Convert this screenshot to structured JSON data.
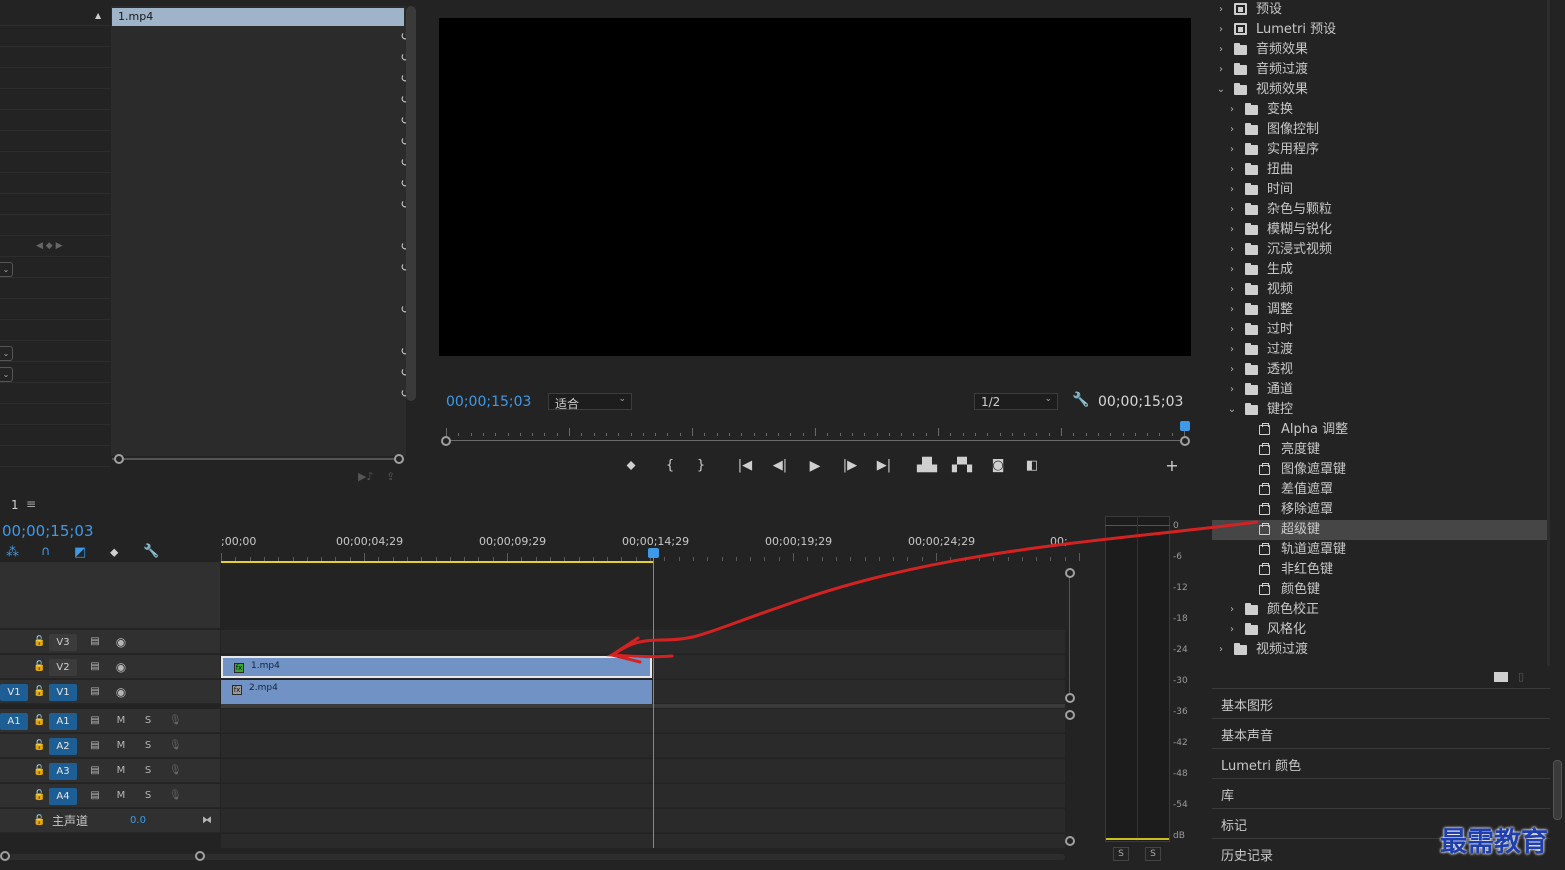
{
  "effect_controls": {
    "clip_name": "1.mp4",
    "reset_rows": 19
  },
  "program": {
    "timecode_left": "00;00;15;03",
    "fit_label": "适合",
    "resolution_label": "1/2",
    "timecode_right": "00;00;15;03"
  },
  "effects_tree": [
    {
      "label": "预设",
      "level": 0,
      "icon": "preset",
      "open": false
    },
    {
      "label": "Lumetri 预设",
      "level": 0,
      "icon": "preset",
      "open": false
    },
    {
      "label": "音频效果",
      "level": 0,
      "icon": "folder",
      "open": false
    },
    {
      "label": "音频过渡",
      "level": 0,
      "icon": "folder",
      "open": false
    },
    {
      "label": "视频效果",
      "level": 0,
      "icon": "folder",
      "open": true
    },
    {
      "label": "变换",
      "level": 1,
      "icon": "folder",
      "open": false
    },
    {
      "label": "图像控制",
      "level": 1,
      "icon": "folder",
      "open": false
    },
    {
      "label": "实用程序",
      "level": 1,
      "icon": "folder",
      "open": false
    },
    {
      "label": "扭曲",
      "level": 1,
      "icon": "folder",
      "open": false
    },
    {
      "label": "时间",
      "level": 1,
      "icon": "folder",
      "open": false
    },
    {
      "label": "杂色与颗粒",
      "level": 1,
      "icon": "folder",
      "open": false
    },
    {
      "label": "模糊与锐化",
      "level": 1,
      "icon": "folder",
      "open": false
    },
    {
      "label": "沉浸式视频",
      "level": 1,
      "icon": "folder",
      "open": false
    },
    {
      "label": "生成",
      "level": 1,
      "icon": "folder",
      "open": false
    },
    {
      "label": "视频",
      "level": 1,
      "icon": "folder",
      "open": false
    },
    {
      "label": "调整",
      "level": 1,
      "icon": "folder",
      "open": false
    },
    {
      "label": "过时",
      "level": 1,
      "icon": "folder",
      "open": false
    },
    {
      "label": "过渡",
      "level": 1,
      "icon": "folder",
      "open": false
    },
    {
      "label": "透视",
      "level": 1,
      "icon": "folder",
      "open": false
    },
    {
      "label": "通道",
      "level": 1,
      "icon": "folder",
      "open": false
    },
    {
      "label": "键控",
      "level": 1,
      "icon": "folder",
      "open": true
    },
    {
      "label": "Alpha 调整",
      "level": 2,
      "icon": "effect"
    },
    {
      "label": "亮度键",
      "level": 2,
      "icon": "effect"
    },
    {
      "label": "图像遮罩键",
      "level": 2,
      "icon": "effect"
    },
    {
      "label": "差值遮罩",
      "level": 2,
      "icon": "effect"
    },
    {
      "label": "移除遮罩",
      "level": 2,
      "icon": "effect"
    },
    {
      "label": "超级键",
      "level": 2,
      "icon": "effect",
      "selected": true
    },
    {
      "label": "轨道遮罩键",
      "level": 2,
      "icon": "effect"
    },
    {
      "label": "非红色键",
      "level": 2,
      "icon": "effect"
    },
    {
      "label": "颜色键",
      "level": 2,
      "icon": "effect"
    },
    {
      "label": "颜色校正",
      "level": 1,
      "icon": "folder",
      "open": false
    },
    {
      "label": "风格化",
      "level": 1,
      "icon": "folder",
      "open": false
    },
    {
      "label": "视频过渡",
      "level": 0,
      "icon": "folder",
      "open": false
    }
  ],
  "side_tabs": [
    "基本图形",
    "基本声音",
    "Lumetri 颜色",
    "库",
    "标记",
    "历史记录"
  ],
  "timeline": {
    "sequence_name": "1",
    "timecode": "00;00;15;03",
    "ruler_labels": [
      ";00;00",
      "00;00;04;29",
      "00;00;09;29",
      "00;00;14;29",
      "00;00;19;29",
      "00;00;24;29",
      "00;"
    ],
    "video_tracks": [
      {
        "name": "V3",
        "source": ""
      },
      {
        "name": "V2",
        "source": ""
      },
      {
        "name": "V1",
        "source": "V1"
      }
    ],
    "audio_tracks": [
      {
        "name": "A1",
        "source": "A1"
      },
      {
        "name": "A2",
        "source": ""
      },
      {
        "name": "A3",
        "source": ""
      },
      {
        "name": "A4",
        "source": ""
      }
    ],
    "mute_label": "M",
    "solo_label": "S",
    "master_label": "主声道",
    "master_value": "0.0",
    "clips": [
      {
        "name": "1.mp4",
        "track": "V2"
      },
      {
        "name": "2.mp4",
        "track": "V1"
      }
    ]
  },
  "meter": {
    "db_labels": [
      "0",
      "-6",
      "-12",
      "-18",
      "-24",
      "-30",
      "-36",
      "-42",
      "-48",
      "-54",
      "dB"
    ],
    "solo_buttons": [
      "S",
      "S"
    ]
  },
  "watermark": "最需教育",
  "colors": {
    "accent_blue": "#3e9ae8",
    "clip_blue": "#7092c5",
    "annotation_red": "#d42222",
    "work_area_yellow": "#e6d12a"
  }
}
